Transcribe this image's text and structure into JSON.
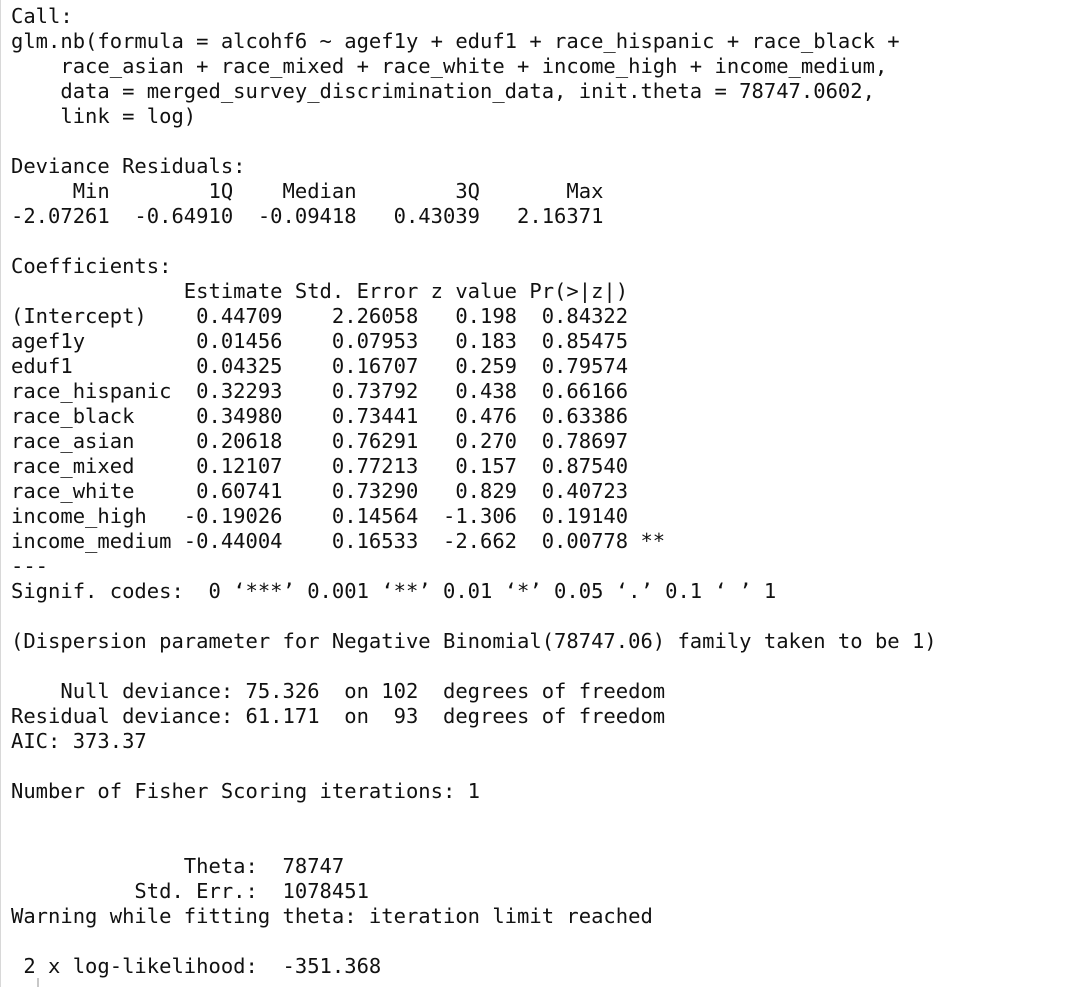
{
  "console": {
    "lines": [
      "Call:",
      "glm.nb(formula = alcohf6 ~ agef1y + eduf1 + race_hispanic + race_black + ",
      "    race_asian + race_mixed + race_white + income_high + income_medium, ",
      "    data = merged_survey_discrimination_data, init.theta = 78747.0602, ",
      "    link = log)",
      "",
      "Deviance Residuals: ",
      "     Min        1Q    Median        3Q       Max  ",
      "-2.07261  -0.64910  -0.09418   0.43039   2.16371  ",
      "",
      "Coefficients:",
      "              Estimate Std. Error z value Pr(>|z|)   ",
      "(Intercept)    0.44709    2.26058   0.198  0.84322   ",
      "agef1y         0.01456    0.07953   0.183  0.85475   ",
      "eduf1          0.04325    0.16707   0.259  0.79574   ",
      "race_hispanic  0.32293    0.73792   0.438  0.66166   ",
      "race_black     0.34980    0.73441   0.476  0.63386   ",
      "race_asian     0.20618    0.76291   0.270  0.78697   ",
      "race_mixed     0.12107    0.77213   0.157  0.87540   ",
      "race_white     0.60741    0.73290   0.829  0.40723   ",
      "income_high   -0.19026    0.14564  -1.306  0.19140   ",
      "income_medium -0.44004    0.16533  -2.662  0.00778 **",
      "---",
      "Signif. codes:  0 ‘***’ 0.001 ‘**’ 0.01 ‘*’ 0.05 ‘.’ 0.1 ‘ ’ 1",
      "",
      "(Dispersion parameter for Negative Binomial(78747.06) family taken to be 1)",
      "",
      "    Null deviance: 75.326  on 102  degrees of freedom",
      "Residual deviance: 61.171  on  93  degrees of freedom",
      "AIC: 373.37",
      "",
      "Number of Fisher Scoring iterations: 1",
      "",
      "",
      "              Theta:  78747 ",
      "          Std. Err.:  1078451 ",
      "Warning while fitting theta: iteration limit reached ",
      "",
      " 2 x log-likelihood:  -351.368 "
    ]
  }
}
